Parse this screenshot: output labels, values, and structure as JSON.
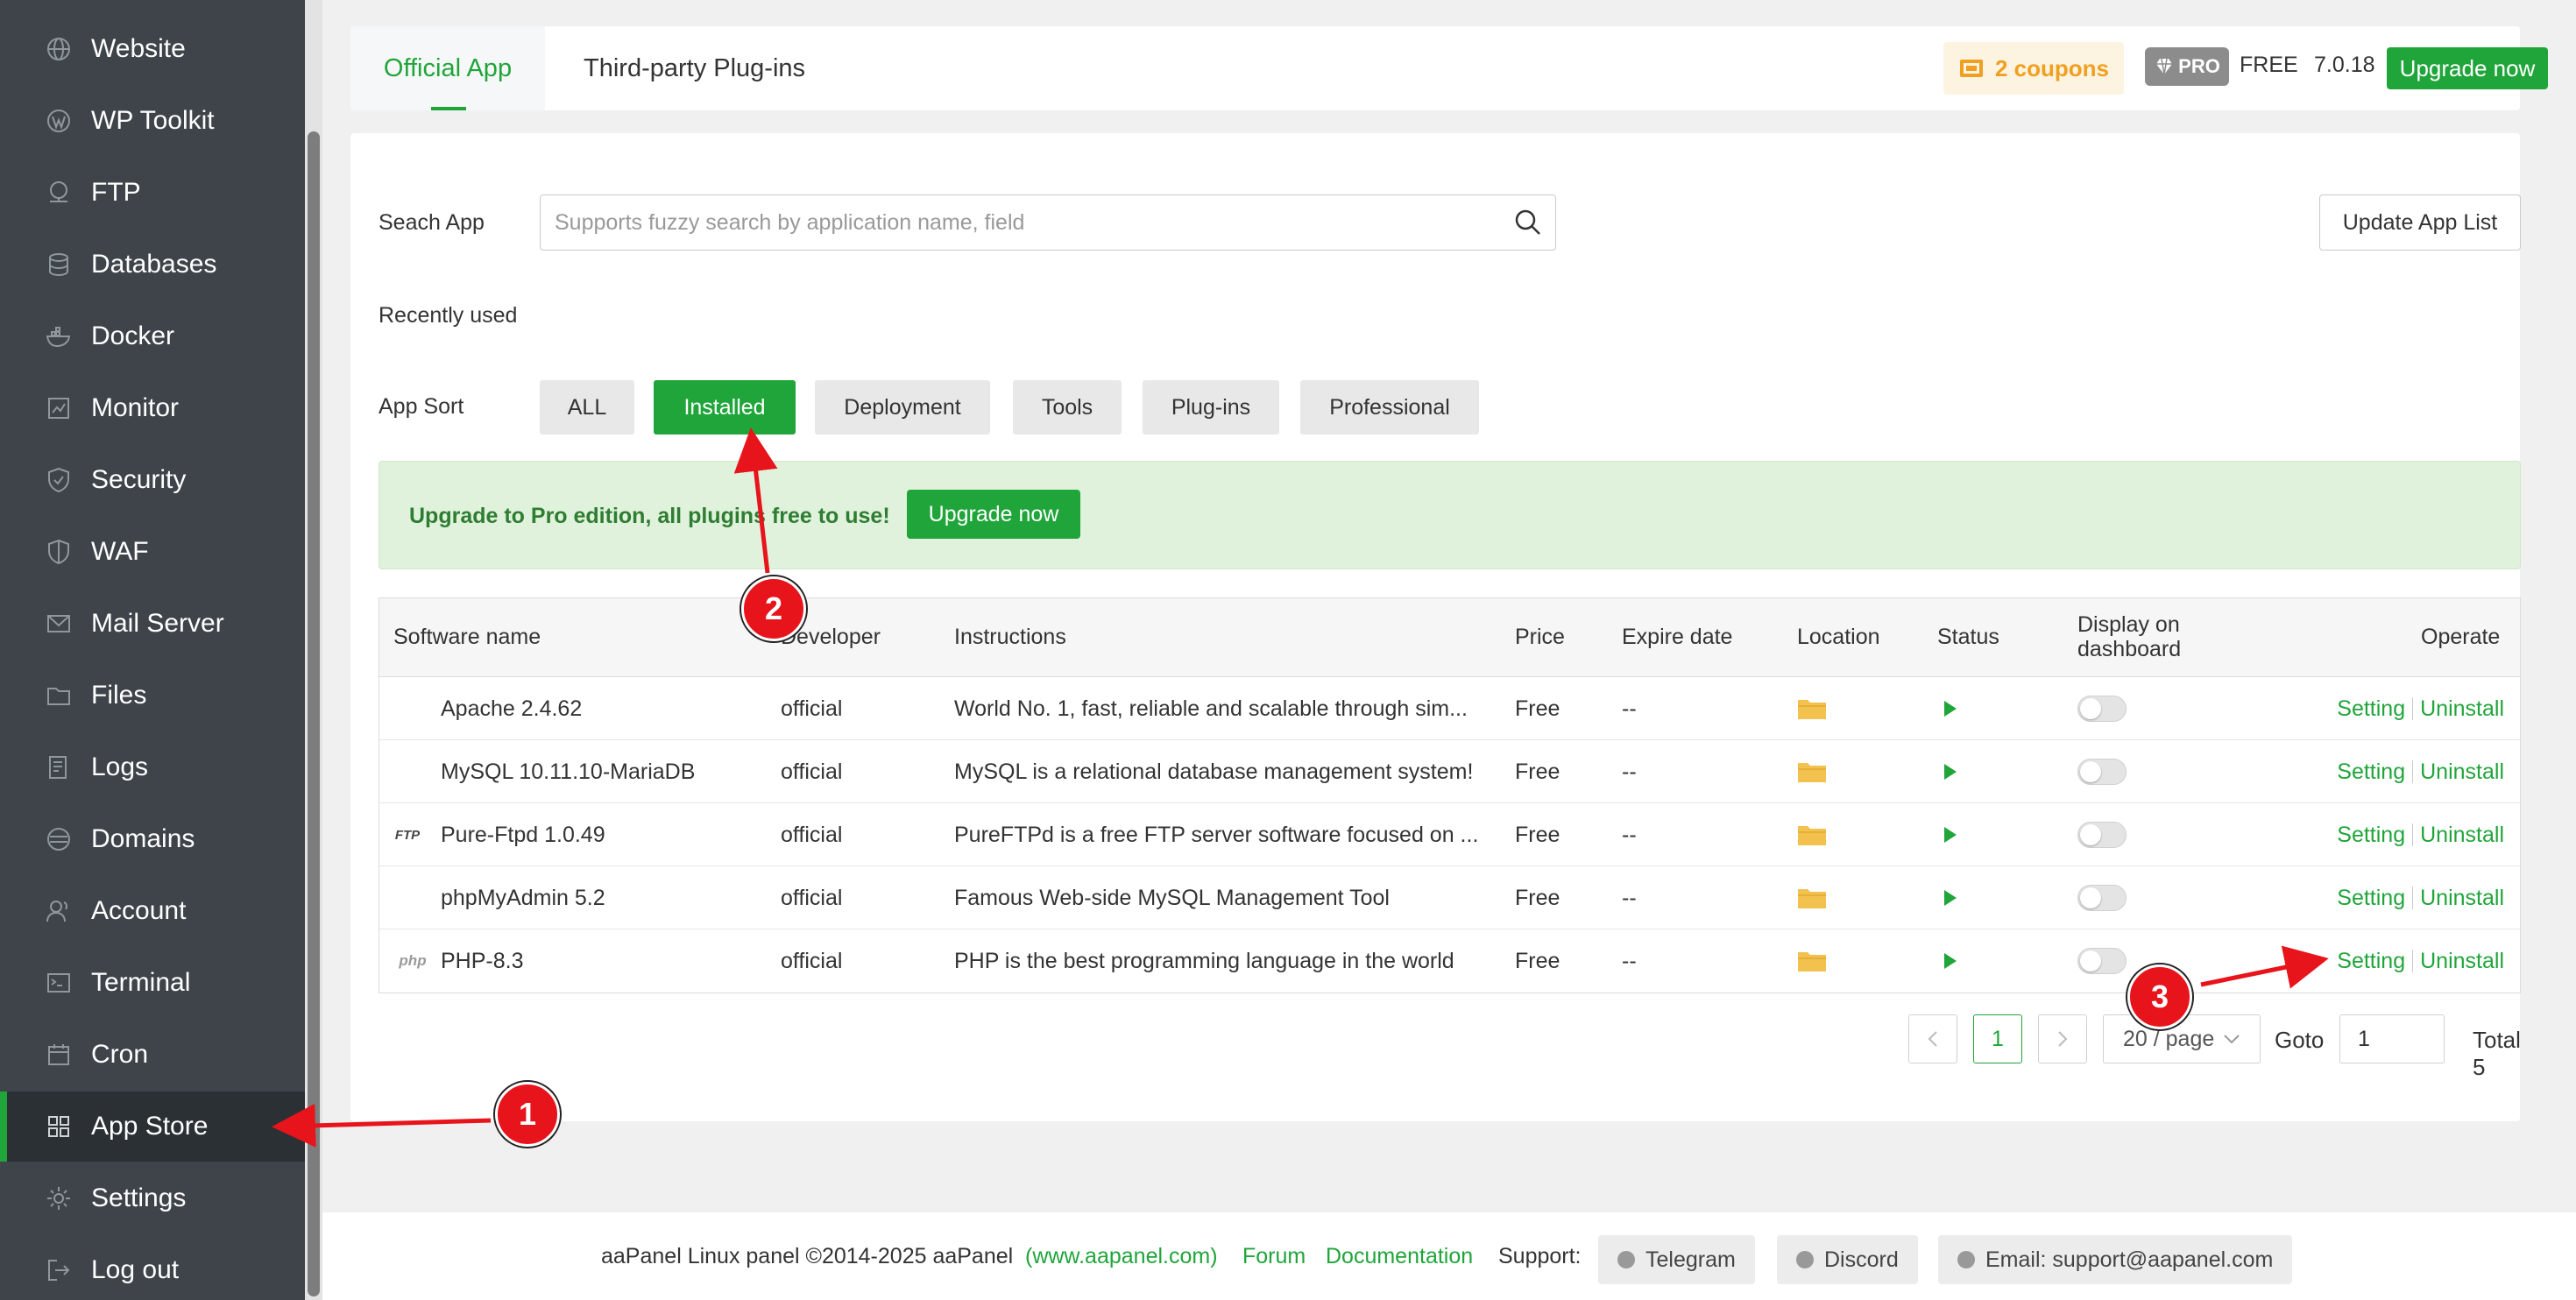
{
  "sidebar": {
    "items": [
      {
        "label": "Website",
        "icon": "globe-icon"
      },
      {
        "label": "WP Toolkit",
        "icon": "wordpress-icon"
      },
      {
        "label": "FTP",
        "icon": "ftp-icon"
      },
      {
        "label": "Databases",
        "icon": "database-icon"
      },
      {
        "label": "Docker",
        "icon": "docker-icon"
      },
      {
        "label": "Monitor",
        "icon": "monitor-icon"
      },
      {
        "label": "Security",
        "icon": "shield-icon"
      },
      {
        "label": "WAF",
        "icon": "waf-shield-icon"
      },
      {
        "label": "Mail Server",
        "icon": "mail-icon"
      },
      {
        "label": "Files",
        "icon": "folder-icon"
      },
      {
        "label": "Logs",
        "icon": "logs-icon"
      },
      {
        "label": "Domains",
        "icon": "domains-icon"
      },
      {
        "label": "Account",
        "icon": "account-icon"
      },
      {
        "label": "Terminal",
        "icon": "terminal-icon"
      },
      {
        "label": "Cron",
        "icon": "calendar-icon"
      },
      {
        "label": "App Store",
        "icon": "grid-icon",
        "active": true
      },
      {
        "label": "Settings",
        "icon": "gear-icon"
      },
      {
        "label": "Log out",
        "icon": "logout-icon"
      }
    ]
  },
  "topbar": {
    "tabs": [
      "Official App",
      "Third-party Plug-ins"
    ],
    "coupons": "2 coupons",
    "pro_badge": "PRO",
    "edition": "FREE",
    "version": "7.0.18",
    "upgrade": "Upgrade now"
  },
  "search": {
    "label": "Seach App",
    "placeholder": "Supports fuzzy search by application name, field",
    "value": "",
    "update_button": "Update App List"
  },
  "recent": {
    "label": "Recently used"
  },
  "sort": {
    "label": "App Sort",
    "buttons": [
      "ALL",
      "Installed",
      "Deployment",
      "Tools",
      "Plug-ins",
      "Professional"
    ],
    "active": "Installed"
  },
  "promo": {
    "text": "Upgrade to Pro edition, all plugins  free to use!",
    "button": "Upgrade now"
  },
  "table": {
    "headers": [
      "Software name",
      "Developer",
      "Instructions",
      "Price",
      "Expire date",
      "Location",
      "Status",
      "Display on",
      "dashboard",
      "Operate"
    ],
    "rows": [
      {
        "name": "Apache 2.4.62",
        "developer": "official",
        "instructions": "World No. 1, fast, reliable and scalable through sim...",
        "price": "Free",
        "expire": "--",
        "setting": "Setting",
        "uninstall": "Uninstall"
      },
      {
        "name": "MySQL 10.11.10-MariaDB",
        "developer": "official",
        "instructions": "MySQL is a relational database management system!",
        "price": "Free",
        "expire": "--",
        "setting": "Setting",
        "uninstall": "Uninstall"
      },
      {
        "name": "Pure-Ftpd 1.0.49",
        "developer": "official",
        "instructions": "PureFTPd is a free FTP server software focused on ...",
        "price": "Free",
        "expire": "--",
        "setting": "Setting",
        "uninstall": "Uninstall"
      },
      {
        "name": "phpMyAdmin 5.2",
        "developer": "official",
        "instructions": "Famous Web-side MySQL Management Tool",
        "price": "Free",
        "expire": "--",
        "setting": "Setting",
        "uninstall": "Uninstall"
      },
      {
        "name": "PHP-8.3",
        "developer": "official",
        "instructions": "PHP is the best programming language in the world",
        "price": "Free",
        "expire": "--",
        "setting": "Setting",
        "uninstall": "Uninstall"
      }
    ],
    "icons": [
      "apache-feather-icon",
      "mysql-dolphin-icon",
      "ftp-logo-icon",
      "phpmyadmin-sail-icon",
      "php-logo-icon"
    ],
    "icon_texts": [
      "",
      "",
      "FTP",
      "",
      "php"
    ]
  },
  "pagination": {
    "current": "1",
    "page_size": "20 / page",
    "goto_label": "Goto",
    "goto_value": "1",
    "total": "Total 5"
  },
  "footer": {
    "copyright": "aaPanel Linux panel ©2014-2025 aaPanel",
    "site": "(www.aapanel.com)",
    "forum": "Forum",
    "docs": "Documentation",
    "support": "Support:",
    "telegram": "Telegram",
    "discord": "Discord",
    "email": "Email: support@aapanel.com"
  },
  "annotations": [
    "1",
    "2",
    "3"
  ],
  "colors": {
    "accent": "#20a53a",
    "sidebar": "#3e444a",
    "marker": "#e8141c",
    "coupon": "#f0a020",
    "folder": "#f2c14e"
  }
}
